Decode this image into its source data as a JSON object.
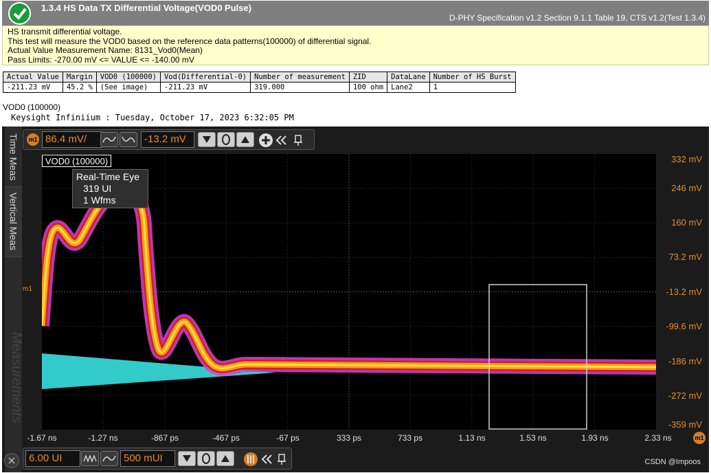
{
  "header": {
    "title": "1.3.4 HS Data TX Differential Voltage(VOD0 Pulse)",
    "spec": "D-PHY Specification v1.2 Section 9.1.1 Table 19, CTS v1.2(Test 1.3.4)"
  },
  "description": {
    "line1": "HS transmit differential voltage.",
    "line2": "This test will measure the VOD0 based on the reference data patterns(100000) of differential signal.",
    "line3": "Actual Value Measurement Name: 8131_Vod0(Mean)",
    "line4": "Pass Limits: -270.00 mV <= VALUE <= -140.00 mV"
  },
  "results_table": {
    "headers": [
      "Actual Value",
      "Margin",
      "VOD0 (100000)",
      "Vod(Differential-0)",
      "Number of measurement",
      "ZID",
      "DataLane",
      "Number of HS Burst"
    ],
    "row": [
      "-211.23 mV",
      "45.2 %",
      "(See image)",
      "-211.23 mV",
      "319.000",
      "100 ohm",
      "Lane2",
      "1"
    ]
  },
  "image_label": "VOD0 (100000)",
  "scope_caption": "Keysight Infiniium : Tuesday, October 17, 2023 6:32:05 PM",
  "scope": {
    "side_tabs": {
      "time": "Time Meas",
      "vertical": "Vertical Meas",
      "measurements": "Measurements"
    },
    "top_toolbar": {
      "marker": "m1",
      "scale": "86.4 mV/",
      "offset": "-13.2 mV"
    },
    "bottom_toolbar": {
      "scale": "6.00 UI",
      "position": "500 mUI"
    },
    "trace_label": "VOD0 (100000)",
    "eye_popup": {
      "title": "Real-Time Eye",
      "ui": "319 UI",
      "wfms": "1 Wfms"
    },
    "marker_left": "m1",
    "marker_right": "m1",
    "y_labels": [
      "332 mV",
      "246 mV",
      "160 mV",
      "73.2 mV",
      "-13.2 mV",
      "-99.6 mV",
      "-186 mV",
      "-272 mV",
      "-359 mV"
    ],
    "x_labels": [
      "-1.67 ns",
      "-1.27 ns",
      "-867 ps",
      "-467 ps",
      "-67 ps",
      "333 ps",
      "733 ps",
      "1.13 ns",
      "1.53 ns",
      "1.93 ns",
      "2.33 ns"
    ],
    "colors": {
      "accent": "#e88d26",
      "trace_orange": "#ff9a1a",
      "trace_magenta": "#e040d0",
      "trace_cyan": "#38e0e0"
    }
  },
  "watermark": "CSDN @Impoos"
}
